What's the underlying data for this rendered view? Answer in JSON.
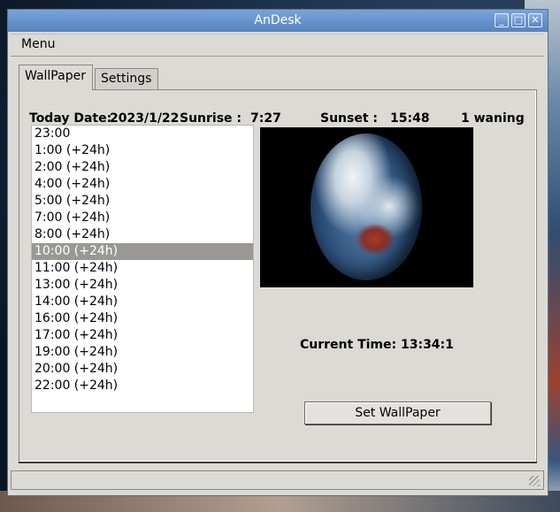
{
  "window": {
    "title": "AnDesk"
  },
  "menu": {
    "label": "Menu"
  },
  "tabs": [
    {
      "label": "WallPaper"
    },
    {
      "label": "Settings"
    }
  ],
  "info": {
    "today_label": "Today Date:",
    "today_value": "2023/1/22",
    "sunrise_label": "Sunrise :",
    "sunrise_value": "7:27",
    "sunset_label": "Sunset :",
    "sunset_value": "15:48",
    "moon_phase": "1 waning"
  },
  "times": [
    "23:00",
    "1:00 (+24h)",
    "2:00 (+24h)",
    "4:00 (+24h)",
    "5:00 (+24h)",
    "7:00 (+24h)",
    "8:00 (+24h)",
    "10:00 (+24h)",
    "11:00 (+24h)",
    "13:00 (+24h)",
    "14:00 (+24h)",
    "16:00 (+24h)",
    "17:00 (+24h)",
    "19:00 (+24h)",
    "20:00 (+24h)",
    "22:00 (+24h)"
  ],
  "selected_index": 7,
  "current_time": "Current Time: 13:34:1",
  "set_button": "Set WallPaper",
  "icons": {
    "minimize": "minimize-icon",
    "maximize": "maximize-icon",
    "close": "close-icon"
  }
}
